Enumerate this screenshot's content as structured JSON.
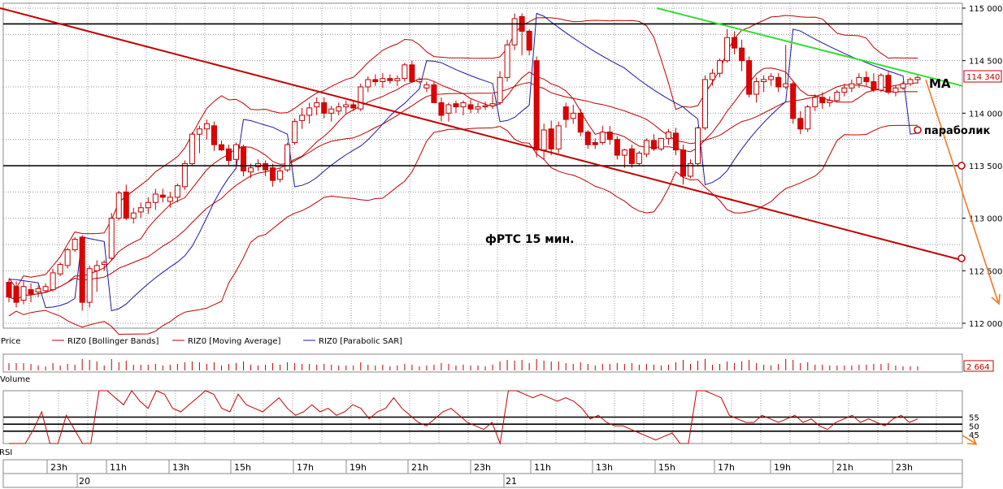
{
  "chart_data": {
    "type": "candlestick",
    "annotation": "фРТС   15 мин.",
    "y_ticks": [
      "112 000",
      "112 500",
      "113 000",
      "113 500",
      "114 000",
      "114 500",
      "115 000"
    ],
    "y_tick_values": [
      112000,
      112500,
      113000,
      113500,
      114000,
      114500,
      115000
    ],
    "ylim": [
      112000,
      115000
    ],
    "last_price": "114 340",
    "volume_value": "2 664",
    "rsi_ticks": [
      "55",
      "50",
      "45"
    ],
    "rsi_tick_values": [
      55,
      50,
      45
    ],
    "x_time_labels": [
      "23h",
      "11h",
      "13h",
      "15h",
      "17h",
      "19h",
      "21h",
      "23h",
      "11h",
      "13h",
      "15h",
      "17h",
      "19h",
      "21h",
      "23h"
    ],
    "x_date_labels": [
      "20",
      "21"
    ],
    "legend": [
      "Price",
      "RIZ0 [Bollinger Bands]",
      "RIZ0 [Moving Average]",
      "RIZ0 [Parabolic SAR]"
    ],
    "panel_labels": {
      "volume": "Volume",
      "rsi": "RSI"
    },
    "marker_labels": {
      "ma": "MA",
      "parabolic": "параболик"
    },
    "horizontal_levels": [
      114850,
      113500
    ],
    "rsi_levels": [
      55,
      51,
      47
    ],
    "trendlines": [
      {
        "name": "descending-channel",
        "color": "#c00000",
        "from": [
          0,
          115000
        ],
        "to": [
          1184,
          112600
        ]
      },
      {
        "name": "resistance",
        "color": "#33dd33",
        "from": [
          808,
          115000
        ],
        "to": [
          1184,
          114260
        ]
      }
    ],
    "candles_ohlc": [
      [
        112390,
        112420,
        112200,
        112250
      ],
      [
        112350,
        112400,
        112150,
        112200
      ],
      [
        112220,
        112400,
        112180,
        112350
      ],
      [
        112320,
        112380,
        112200,
        112280
      ],
      [
        112300,
        112360,
        112250,
        112330
      ],
      [
        112310,
        112380,
        112290,
        112350
      ],
      [
        112320,
        112520,
        112300,
        112480
      ],
      [
        112470,
        112580,
        112450,
        112560
      ],
      [
        112550,
        112720,
        112520,
        112700
      ],
      [
        112700,
        112820,
        112680,
        112800
      ],
      [
        112820,
        112840,
        112120,
        112200
      ],
      [
        112200,
        112550,
        112150,
        112520
      ],
      [
        112500,
        112600,
        112300,
        112550
      ],
      [
        112560,
        112600,
        112500,
        112580
      ],
      [
        112620,
        113050,
        112600,
        113000
      ],
      [
        113000,
        113260,
        112980,
        113240
      ],
      [
        113250,
        113320,
        112980,
        113000
      ],
      [
        113000,
        113100,
        112950,
        113050
      ],
      [
        113060,
        113150,
        113000,
        113100
      ],
      [
        113100,
        113200,
        113040,
        113150
      ],
      [
        113150,
        113280,
        113080,
        113230
      ],
      [
        113220,
        113280,
        113150,
        113200
      ],
      [
        113160,
        113250,
        113100,
        113200
      ],
      [
        113200,
        113330,
        113150,
        113310
      ],
      [
        113300,
        113550,
        113270,
        113520
      ],
      [
        113520,
        113820,
        113500,
        113800
      ],
      [
        113800,
        113880,
        113620,
        113850
      ],
      [
        113850,
        113940,
        113750,
        113900
      ],
      [
        113880,
        113920,
        113640,
        113700
      ],
      [
        113700,
        113740,
        113640,
        113650
      ],
      [
        113660,
        113700,
        113500,
        113550
      ],
      [
        113560,
        113720,
        113500,
        113700
      ],
      [
        113680,
        113700,
        113400,
        113450
      ],
      [
        113440,
        113520,
        113380,
        113480
      ],
      [
        113490,
        113560,
        113450,
        113520
      ],
      [
        113520,
        113550,
        113400,
        113460
      ],
      [
        113480,
        113520,
        113300,
        113360
      ],
      [
        113370,
        113480,
        113340,
        113450
      ],
      [
        113460,
        113720,
        113440,
        113700
      ],
      [
        113720,
        113950,
        113700,
        113920
      ],
      [
        113930,
        114050,
        113850,
        113980
      ],
      [
        113980,
        114100,
        113900,
        114050
      ],
      [
        114060,
        114150,
        113980,
        114100
      ],
      [
        114100,
        114150,
        113950,
        114000
      ],
      [
        114000,
        114070,
        113920,
        114040
      ],
      [
        114020,
        114100,
        113980,
        114060
      ],
      [
        114060,
        114120,
        114000,
        114080
      ],
      [
        114080,
        114120,
        114020,
        114050
      ],
      [
        114040,
        114280,
        114020,
        114250
      ],
      [
        114250,
        114350,
        114200,
        114320
      ],
      [
        114320,
        114370,
        114260,
        114300
      ],
      [
        114300,
        114380,
        114240,
        114330
      ],
      [
        114330,
        114370,
        114280,
        114310
      ],
      [
        114310,
        114360,
        114260,
        114330
      ],
      [
        114330,
        114480,
        114300,
        114460
      ],
      [
        114460,
        114500,
        114350,
        114300
      ],
      [
        114300,
        114340,
        114280,
        114320
      ],
      [
        114240,
        114300,
        114200,
        114270
      ],
      [
        114270,
        114300,
        114150,
        114100
      ],
      [
        114100,
        114150,
        113920,
        113980
      ],
      [
        114000,
        114100,
        113920,
        114080
      ],
      [
        114090,
        114120,
        114000,
        114060
      ],
      [
        114060,
        114120,
        113980,
        114100
      ],
      [
        114080,
        114130,
        114000,
        114040
      ],
      [
        114040,
        114100,
        114000,
        114060
      ],
      [
        114060,
        114110,
        114030,
        114070
      ],
      [
        114070,
        114180,
        114040,
        114090
      ],
      [
        114100,
        114400,
        114080,
        114340
      ],
      [
        114340,
        114700,
        114300,
        114650
      ],
      [
        114650,
        114950,
        114600,
        114900
      ],
      [
        114920,
        114950,
        114550,
        114780
      ],
      [
        114780,
        114800,
        114550,
        114600
      ],
      [
        114500,
        114540,
        113580,
        113650
      ],
      [
        113650,
        113900,
        113560,
        113840
      ],
      [
        113850,
        113930,
        113600,
        113660
      ],
      [
        113660,
        113920,
        113620,
        113880
      ],
      [
        114060,
        114100,
        113860,
        113940
      ],
      [
        113950,
        114080,
        113900,
        114000
      ],
      [
        114000,
        114040,
        113780,
        113820
      ],
      [
        113820,
        113840,
        113660,
        113700
      ],
      [
        113720,
        113760,
        113660,
        113700
      ],
      [
        113720,
        113880,
        113700,
        113820
      ],
      [
        113820,
        113880,
        113700,
        113750
      ],
      [
        113750,
        113780,
        113560,
        113600
      ],
      [
        113600,
        113660,
        113480,
        113650
      ],
      [
        113660,
        113700,
        113480,
        113520
      ],
      [
        113520,
        113640,
        113500,
        113620
      ],
      [
        113610,
        113760,
        113580,
        113740
      ],
      [
        113740,
        113800,
        113640,
        113660
      ],
      [
        113660,
        113760,
        113640,
        113760
      ],
      [
        113760,
        113850,
        113700,
        113820
      ],
      [
        113810,
        113860,
        113600,
        113650
      ],
      [
        113650,
        113700,
        113320,
        113400
      ],
      [
        113400,
        113560,
        113380,
        113520
      ],
      [
        113520,
        113870,
        113500,
        113860
      ],
      [
        113860,
        114360,
        113840,
        114320
      ],
      [
        114320,
        114420,
        114260,
        114380
      ],
      [
        114380,
        114520,
        114340,
        114500
      ],
      [
        114500,
        114800,
        114480,
        114720
      ],
      [
        114720,
        114780,
        114560,
        114620
      ],
      [
        114620,
        114700,
        114400,
        114500
      ],
      [
        114500,
        114540,
        114150,
        114180
      ],
      [
        114180,
        114340,
        114100,
        114300
      ],
      [
        114300,
        114360,
        114200,
        114320
      ],
      [
        114320,
        114380,
        114260,
        114350
      ],
      [
        114340,
        114380,
        114200,
        114250
      ],
      [
        114250,
        114650,
        114230,
        114280
      ],
      [
        114280,
        114300,
        113900,
        113950
      ],
      [
        113950,
        114020,
        113800,
        113850
      ],
      [
        113850,
        114080,
        113820,
        114060
      ],
      [
        114060,
        114180,
        114020,
        114150
      ],
      [
        114150,
        114200,
        114040,
        114100
      ],
      [
        114100,
        114160,
        114060,
        114120
      ],
      [
        114120,
        114220,
        114100,
        114200
      ],
      [
        114200,
        114280,
        114160,
        114240
      ],
      [
        114240,
        114320,
        114200,
        114280
      ],
      [
        114280,
        114380,
        114240,
        114340
      ],
      [
        114340,
        114400,
        114260,
        114300
      ],
      [
        114300,
        114380,
        114200,
        114220
      ],
      [
        114220,
        114380,
        114200,
        114360
      ],
      [
        114360,
        114400,
        114180,
        114200
      ],
      [
        114200,
        114260,
        114160,
        114240
      ],
      [
        114240,
        114300,
        114220,
        114280
      ],
      [
        114280,
        114340,
        114260,
        114320
      ],
      [
        114320,
        114360,
        114280,
        114340
      ]
    ],
    "rsi_values": [
      40,
      40,
      40,
      48,
      58,
      40,
      40,
      56,
      48,
      40,
      40,
      70,
      70,
      66,
      62,
      70,
      64,
      60,
      70,
      68,
      60,
      58,
      62,
      66,
      70,
      68,
      60,
      58,
      68,
      62,
      60,
      58,
      62,
      66,
      60,
      56,
      58,
      62,
      58,
      60,
      56,
      58,
      62,
      60,
      54,
      58,
      60,
      66,
      60,
      56,
      52,
      50,
      54,
      58,
      60,
      56,
      52,
      50,
      48,
      52,
      40,
      70,
      70,
      68,
      66,
      68,
      66,
      64,
      66,
      64,
      60,
      54,
      56,
      52,
      50,
      50,
      48,
      46,
      44,
      42,
      44,
      46,
      40,
      40,
      70,
      70,
      68,
      66,
      56,
      54,
      52,
      52,
      56,
      54,
      52,
      54,
      56,
      52,
      54,
      50,
      48,
      52,
      54,
      56,
      52,
      54,
      52,
      50,
      54,
      56,
      52,
      54
    ]
  }
}
